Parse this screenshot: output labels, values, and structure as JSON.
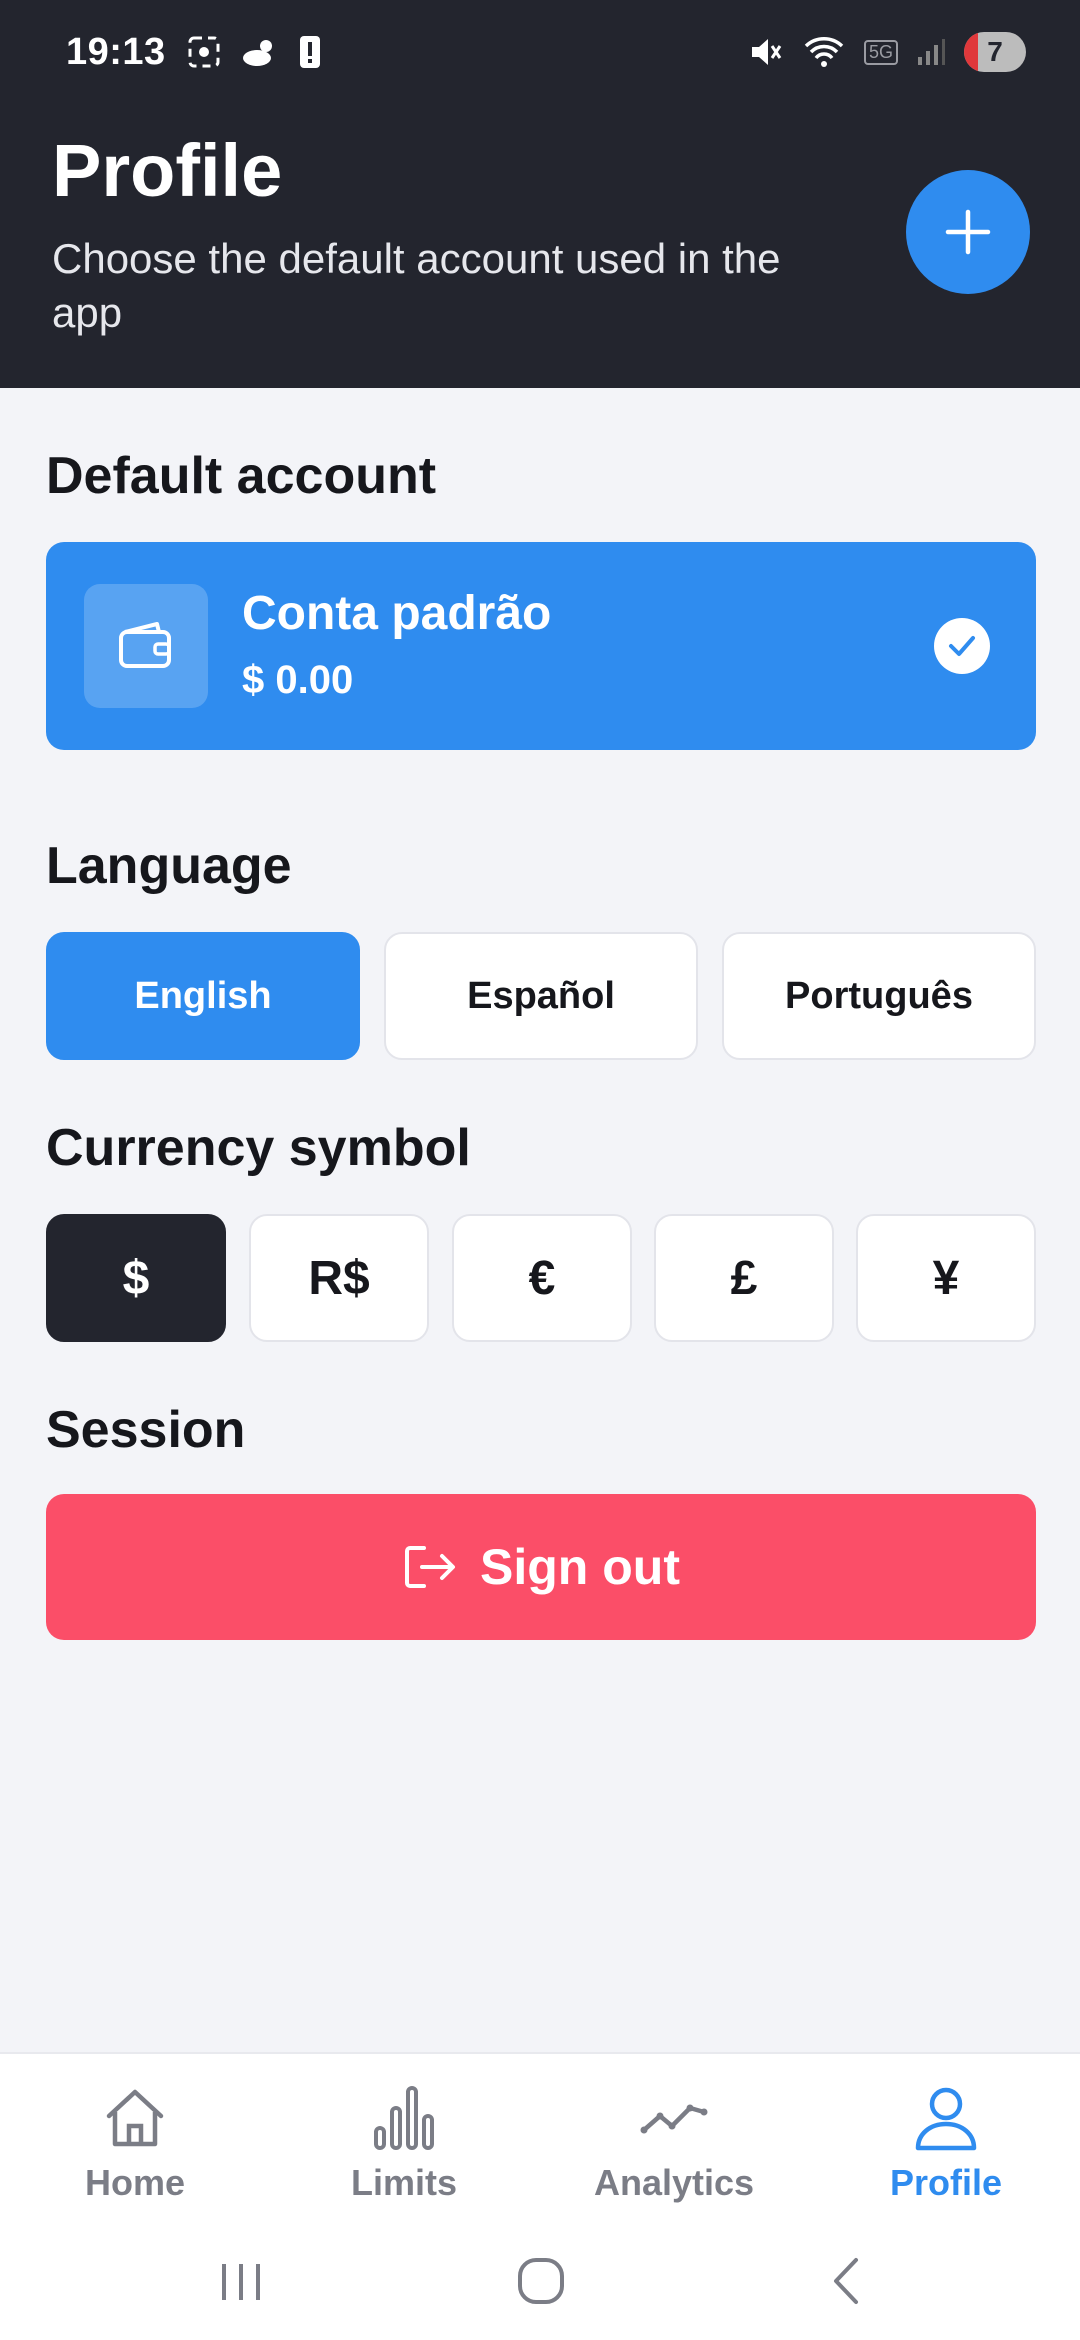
{
  "status_bar": {
    "time": "19:13",
    "network": "5G",
    "battery": "7",
    "icons": [
      "screenshot-icon",
      "weather-icon",
      "alert-icon",
      "mute-icon",
      "wifi-icon",
      "signal-icon"
    ]
  },
  "header": {
    "title": "Profile",
    "subtitle": "Choose the default account used in the app",
    "add_icon": "plus-icon"
  },
  "default_account": {
    "section_title": "Default account",
    "name": "Conta padrão",
    "balance": "$ 0.00",
    "icon": "wallet-icon",
    "selected": true
  },
  "language": {
    "section_title": "Language",
    "options": [
      "English",
      "Español",
      "Português"
    ],
    "selected": "English"
  },
  "currency": {
    "section_title": "Currency symbol",
    "options": [
      "$",
      "R$",
      "€",
      "£",
      "¥"
    ],
    "selected": "$"
  },
  "session": {
    "section_title": "Session",
    "sign_out_label": "Sign out",
    "sign_out_icon": "logout-icon"
  },
  "bottom_nav": {
    "items": [
      {
        "label": "Home",
        "icon": "home-icon"
      },
      {
        "label": "Limits",
        "icon": "bar-chart-icon"
      },
      {
        "label": "Analytics",
        "icon": "line-chart-icon"
      },
      {
        "label": "Profile",
        "icon": "user-icon"
      }
    ],
    "active": "Profile"
  },
  "colors": {
    "header_bg": "#23252e",
    "accent": "#2f8cef",
    "danger": "#fb4e68",
    "background": "#f3f4f8"
  }
}
